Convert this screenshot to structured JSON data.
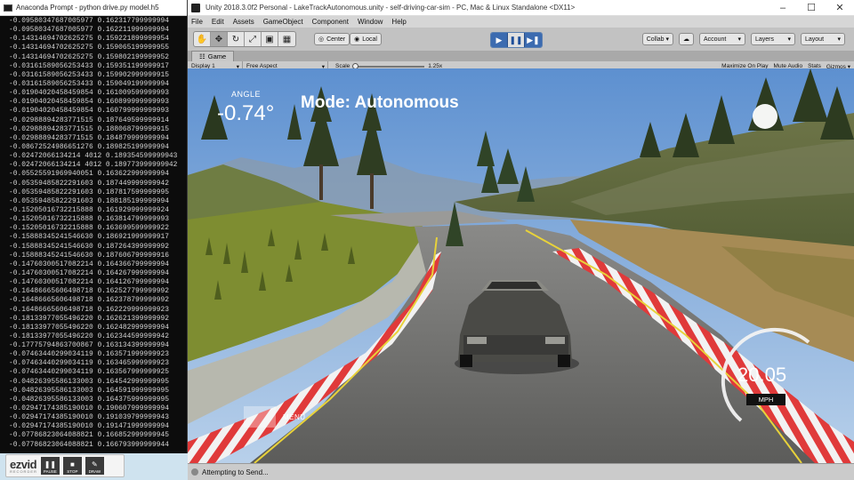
{
  "console": {
    "title": "Anaconda Prompt - python  drive.py model.h5",
    "lines": [
      "-0.09580347687005977 0.162317799999994",
      "-0.09580347687005977 0.162211999999994",
      "-0.14314694702625275 0.159221899999954",
      "-0.14314694702625275 0.159065199999955",
      "-0.14314694702625275 0.159802199999952",
      "-0.03161589056253433 0.159351199999917",
      "-0.03161589056253433 0.159902999999915",
      "-0.03161589056253433 0.159049199999994",
      "-0.01904020458459854 0.161009599999993",
      "-0.01904020458459854 0.160899999999993",
      "-0.01904020458459854 0.160799999999993",
      "-0.02988894283771515 0.187649599999914",
      "-0.02988894283771515 0.188068799999915",
      "-0.02988894283771515 0.184879999999994",
      "-0.08672524986651276 0.189825199999994",
      "-0.02472066134214 4012 0.189354599999943",
      "-0.02472066134214 4012 0.189773999999942",
      "-0.05525591969940051 0.163622999999994",
      "-0.05359485822291603 0.187449999999942",
      "-0.05359485822291603 0.187817599999995",
      "-0.05359485822291603 0.188185199999994",
      "-0.15205016732215888 0.161929999999924",
      "-0.15205016732215888 0.163814799999993",
      "-0.15205016732215888 0.163699599999922",
      "-0.15888345241546630 0.186921999999917",
      "-0.15888345241546630 0.187264399999992",
      "-0.15888345241546630 0.187606799999916",
      "-0.14760300517082214 0.164366799999994",
      "-0.14760300517082214 0.164267999999994",
      "-0.14760300517082214 0.164126799999994",
      "-0.16486665606498718 0.162527799999992",
      "-0.16486665606498718 0.162378799999992",
      "-0.16486665606498718 0.162229999999923",
      "-0.18133977055496220 0.162621399999992",
      "-0.18133977055496220 0.162482999999994",
      "-0.18133977055496220 0.162344599999942",
      "-0.17775794863700867 0.163134399999994",
      "-0.07463440299034119 0.163571999999923",
      "-0.07463440299034119 0.163465999999923",
      "-0.07463440299034119 0.163567999999925",
      "-0.04826395586133003 0.164542999999995",
      "-0.04826395586133003 0.164591999999995",
      "-0.04826395586133003 0.164375999999995",
      "-0.02947174385190010 0.190607999999994",
      "-0.02947174385190010 0.191039799999943",
      "-0.02947174385190010 0.191471999999994",
      "-0.07786823064088821 0.166852999999945",
      "-0.07786823064088821 0.166793999999944"
    ]
  },
  "ezvid": {
    "logo": "ezvid",
    "sub": "RECORDER",
    "buttons": [
      {
        "label": "PAUSE",
        "symbol": "❚❚"
      },
      {
        "label": "STOP",
        "symbol": "■"
      },
      {
        "label": "DRAW",
        "symbol": "✎"
      }
    ]
  },
  "unity": {
    "title": "Unity 2018.3.0f2 Personal - LakeTrackAutonomous.unity - self-driving-car-sim - PC, Mac & Linux Standalone <DX11>",
    "menu": [
      "File",
      "Edit",
      "Assets",
      "GameObject",
      "Component",
      "Window",
      "Help"
    ],
    "pivot": "Center",
    "space": "Local",
    "collab": "Collab ▾",
    "account": "Account",
    "layers": "Layers",
    "layout": "Layout",
    "game_tab": "Game",
    "display": "Display 1",
    "aspect": "Free Aspect",
    "scale_label": "Scale",
    "scale_value": "1.25x",
    "toggles": [
      "Maximize On Play",
      "Mute Audio",
      "Stats",
      "Gizmos ▾"
    ],
    "status": "Attempting to Send..."
  },
  "hud": {
    "angle_label": "ANGLE",
    "angle_value": "-0.74°",
    "mode": "Mode: Autonomous",
    "speed": "20.05",
    "speed_unit": "MPH",
    "menu": "MENU",
    "speed_fraction": 0.6
  },
  "colors": {
    "accent": "#3c6bb0",
    "sky": "#86aedb",
    "road": "#6e6e6e",
    "grass": "#7a8a2c",
    "curb_red": "#d93636"
  }
}
